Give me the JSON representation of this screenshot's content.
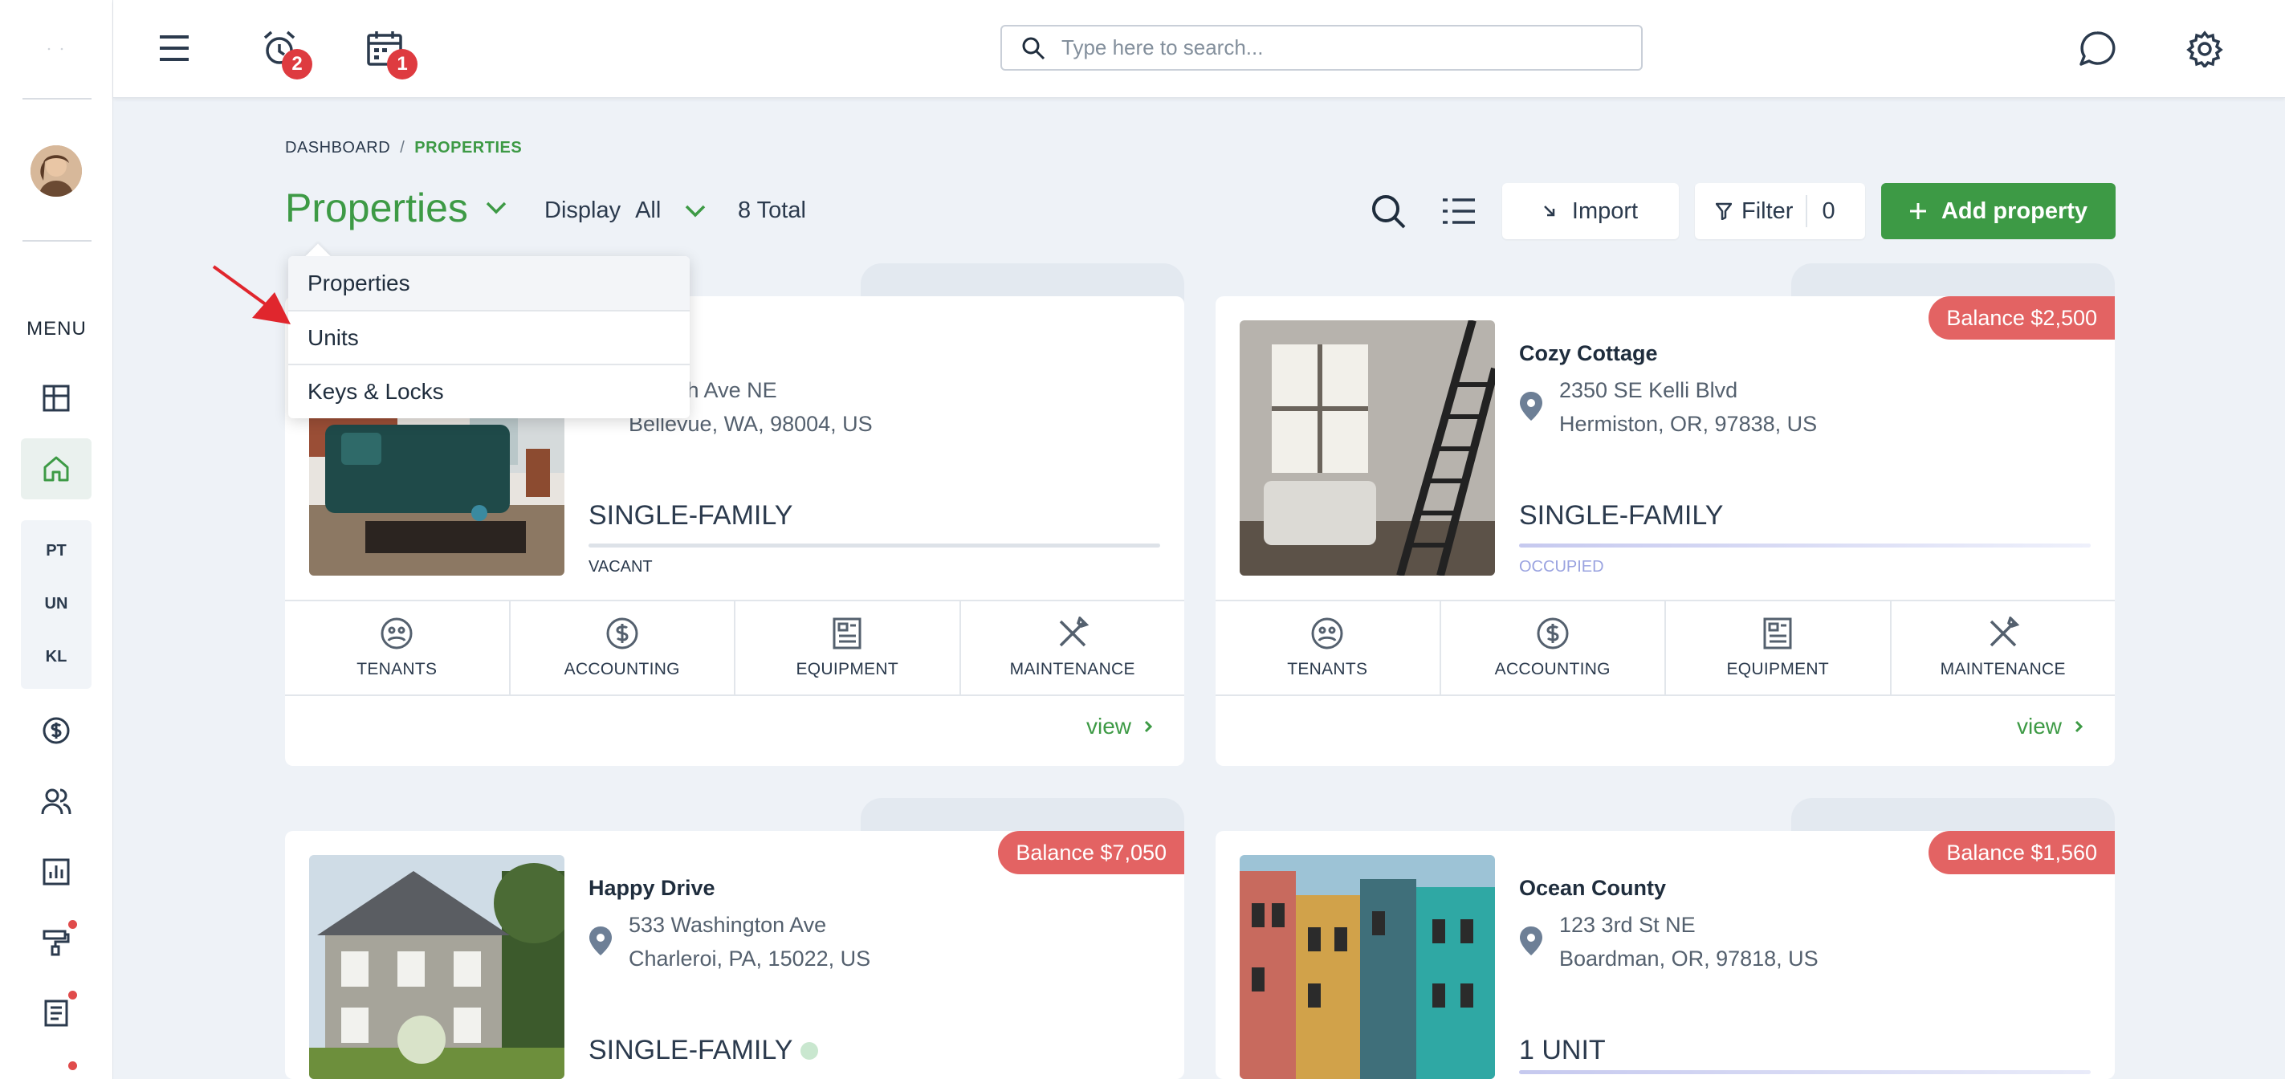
{
  "header": {
    "alarm_badge": "2",
    "calendar_badge": "1",
    "search_placeholder": "Type here to search..."
  },
  "sidebar": {
    "menu_label": "MENU",
    "sub_items": [
      "PT",
      "UN",
      "KL"
    ]
  },
  "breadcrumb": {
    "root": "DASHBOARD",
    "separator": "/",
    "current": "PROPERTIES"
  },
  "toolbar": {
    "title": "Properties",
    "display_label": "Display",
    "display_value": "All",
    "total": "8 Total",
    "import_label": "Import",
    "filter_label": "Filter",
    "filter_count": "0",
    "add_label": "Add property"
  },
  "dropdown": {
    "items": [
      "Properties",
      "Units",
      "Keys & Locks"
    ]
  },
  "action_labels": [
    "TENANTS",
    "ACCOUNTING",
    "EQUIPMENT",
    "MAINTENANCE"
  ],
  "view_label": "view",
  "properties": [
    {
      "name": "",
      "address1": "6th Ave NE",
      "address2": "Bellevue, WA, 98004, US",
      "type": "SINGLE-FAMILY",
      "status": "VACANT",
      "balance": ""
    },
    {
      "name": "Cozy Cottage",
      "address1": "2350 SE Kelli Blvd",
      "address2": "Hermiston, OR, 97838, US",
      "type": "SINGLE-FAMILY",
      "status": "OCCUPIED",
      "balance": "Balance $2,500"
    },
    {
      "name": "Happy Drive",
      "address1": "533 Washington Ave",
      "address2": "Charleroi, PA, 15022, US",
      "type": "SINGLE-FAMILY",
      "status": "",
      "balance": "Balance $7,050"
    },
    {
      "name": "Ocean County",
      "address1": "123 3rd St NE",
      "address2": "Boardman, OR, 97818, US",
      "type": "1 UNIT",
      "status": "",
      "balance": "Balance $1,560"
    }
  ],
  "colors": {
    "accent": "#3d9a45",
    "balance": "#e36363",
    "badge": "#de3b40"
  }
}
